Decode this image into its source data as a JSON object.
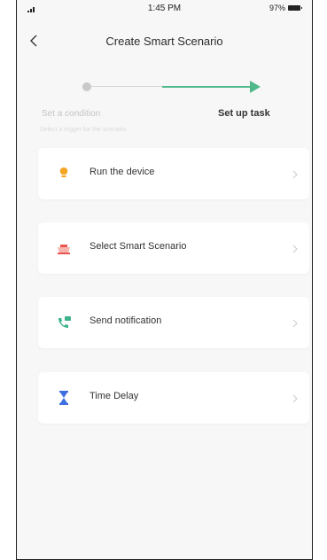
{
  "status_bar": {
    "time": "1:45 PM",
    "battery": "97%"
  },
  "header": {
    "title": "Create Smart Scenario"
  },
  "stepper": {
    "step1_label": "Set a condition",
    "step1_sub": "Select a trigger for the scenario",
    "step2_label": "Set up task"
  },
  "tasks": [
    {
      "label": "Run the device",
      "icon": "lightbulb-icon",
      "color": "#f5a623"
    },
    {
      "label": "Select Smart Scenario",
      "icon": "scene-icon",
      "color": "#e8574f"
    },
    {
      "label": "Send notification",
      "icon": "notification-icon",
      "color": "#3bb38a"
    },
    {
      "label": "Time Delay",
      "icon": "hourglass-icon",
      "color": "#3d6fe0"
    }
  ],
  "colors": {
    "accent": "#4fb88a",
    "background": "#f7f7f7"
  }
}
